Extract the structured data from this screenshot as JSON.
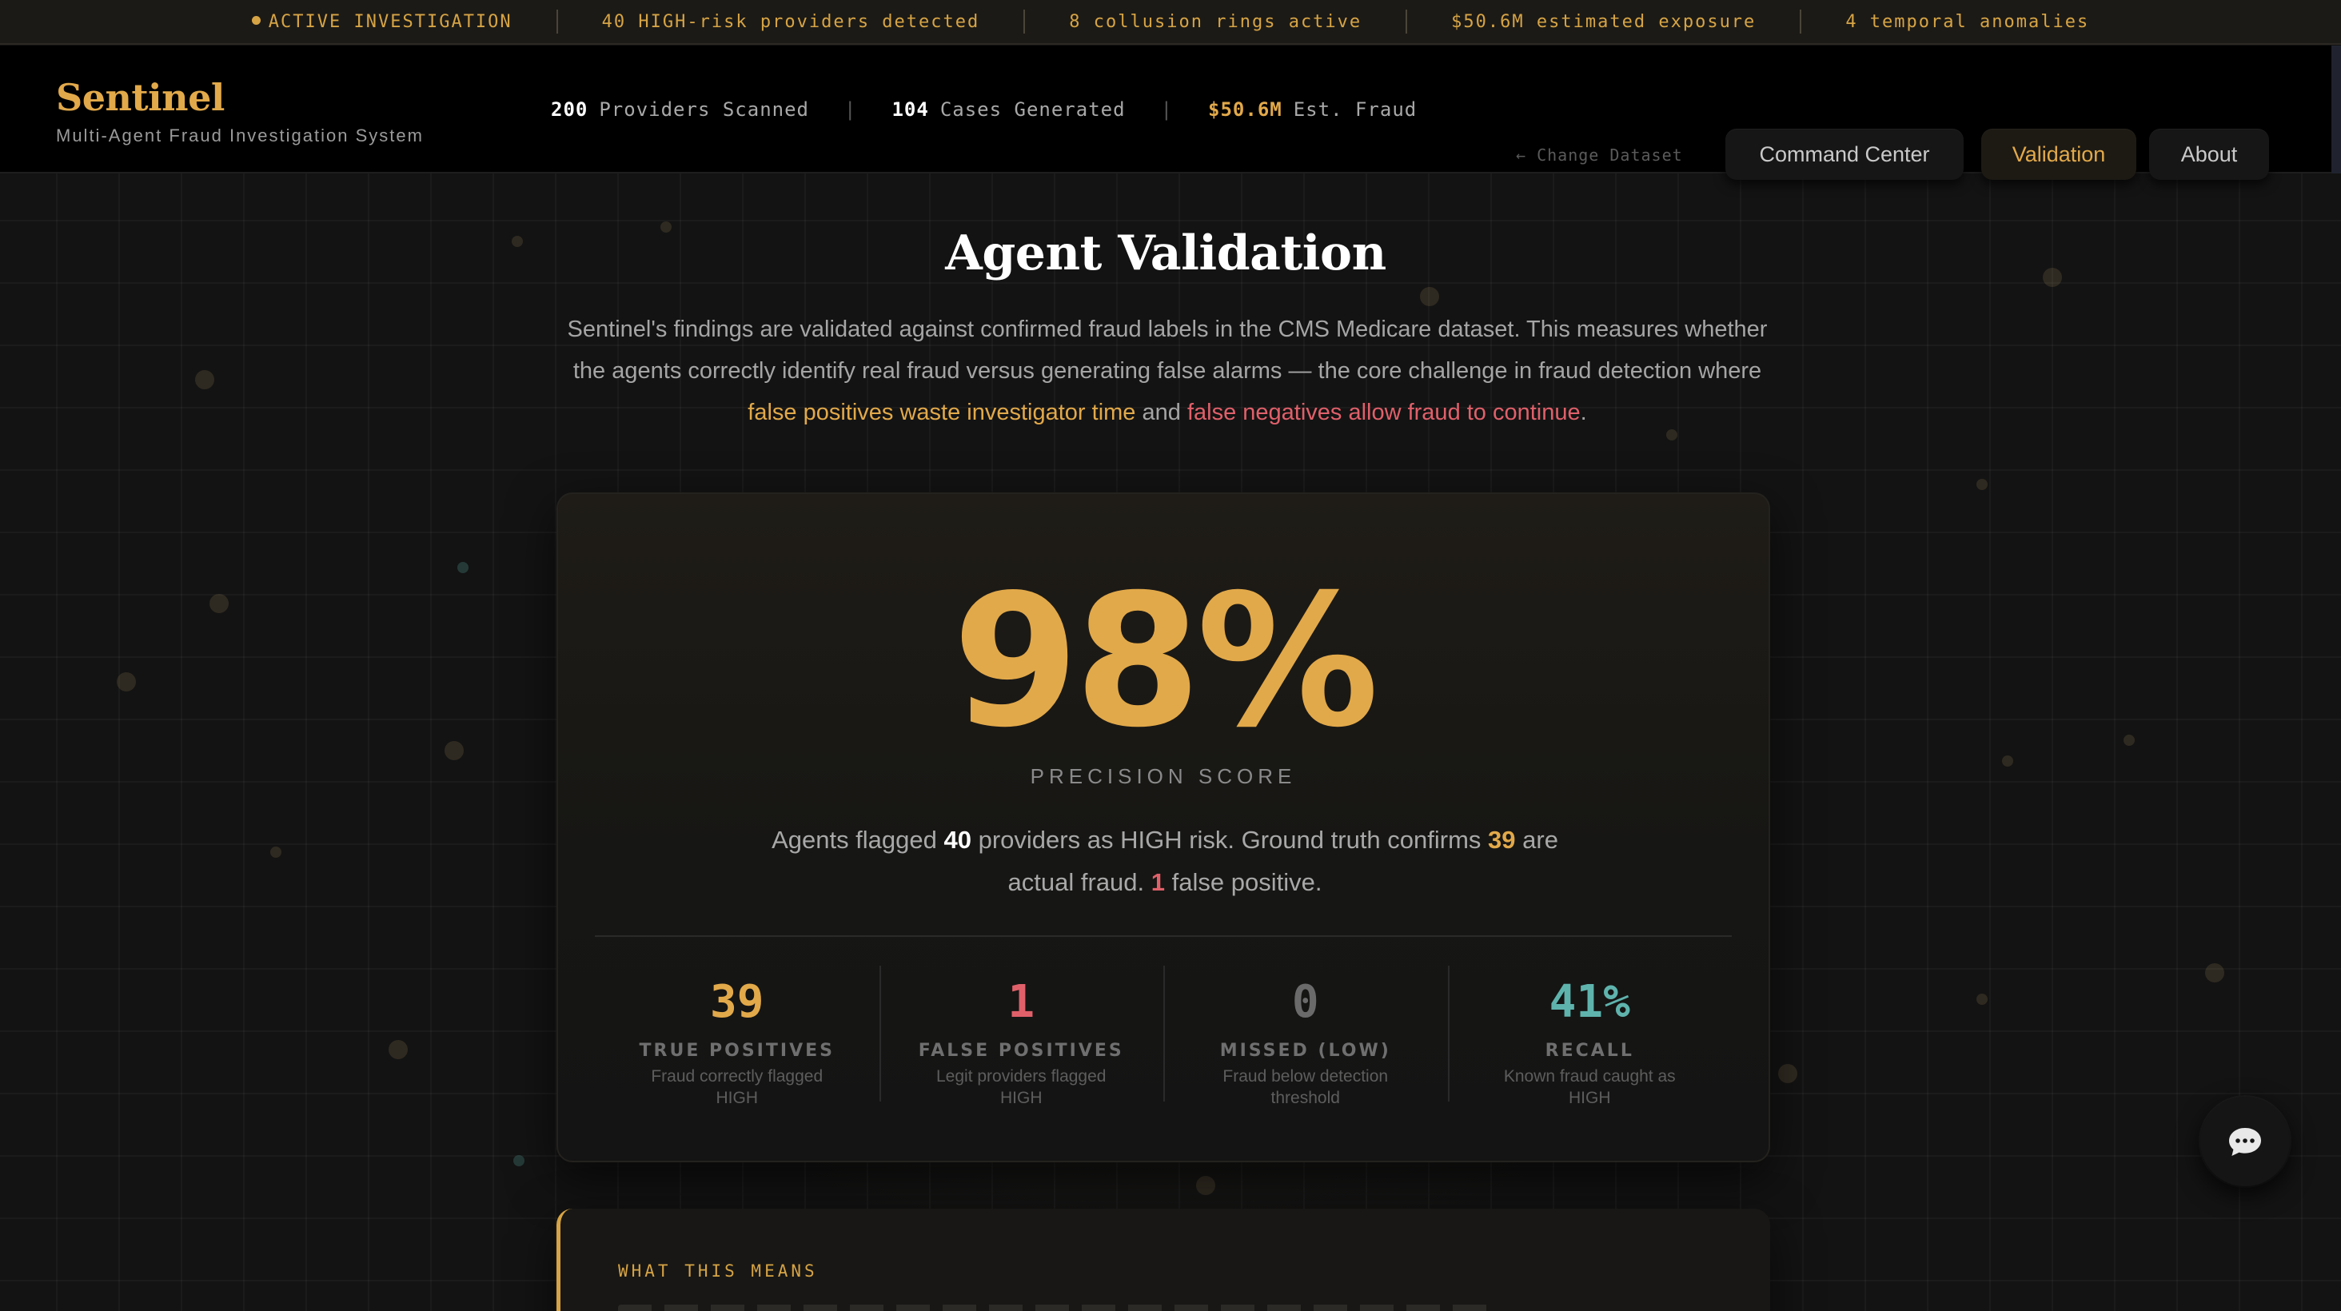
{
  "ticker": {
    "status": "ACTIVE INVESTIGATION",
    "items": [
      "40 HIGH-risk providers detected",
      "8 collusion rings active",
      "$50.6M estimated exposure",
      "4 temporal anomalies"
    ]
  },
  "brand": {
    "name": "Sentinel",
    "subtitle": "Multi-Agent Fraud Investigation System"
  },
  "header_stats": [
    {
      "value": "200",
      "label": "Providers Scanned"
    },
    {
      "value": "104",
      "label": "Cases Generated"
    },
    {
      "value": "$50.6M",
      "label": "Est. Fraud"
    }
  ],
  "change_dataset": "← Change Dataset",
  "nav": {
    "items": [
      "Command Center",
      "Validation",
      "About"
    ],
    "active": "Validation"
  },
  "page": {
    "title": "Agent Validation",
    "intro_text": "Sentinel's findings are validated against confirmed fraud labels in the CMS Medicare dataset. This measures whether the agents correctly identify real fraud versus generating false alarms — the core challenge in fraud detection where ",
    "intro_highlight_1": "false positives waste investigator time",
    "intro_connector": " and ",
    "intro_highlight_2": "false negatives allow fraud to continue",
    "intro_end": "."
  },
  "precision": {
    "score": "98%",
    "label": "PRECISION SCORE",
    "summary": {
      "p1": "Agents flagged ",
      "flagged": "40",
      "p2": " providers as HIGH risk. Ground truth confirms ",
      "confirmed": "39",
      "p3": " are actual fraud. ",
      "false_pos": "1",
      "p4": " false positive."
    }
  },
  "metrics": [
    {
      "value": "39",
      "label": "TRUE POSITIVES",
      "desc": "Fraud correctly flagged HIGH",
      "color": "#e2a94a"
    },
    {
      "value": "1",
      "label": "FALSE POSITIVES",
      "desc": "Legit providers flagged HIGH",
      "color": "#e0606a"
    },
    {
      "value": "0",
      "label": "MISSED (LOW)",
      "desc": "Fraud below detection threshold",
      "color": "#6a6a6a"
    },
    {
      "value": "41%",
      "label": "RECALL",
      "desc": "Known fraud caught as HIGH",
      "color": "#5fb3ad"
    }
  ],
  "what_this_means": {
    "eyebrow": "WHAT THIS MEANS"
  },
  "colors": {
    "accent_gold": "#e2a94a",
    "accent_red": "#e0606a",
    "accent_teal": "#5fb3ad",
    "background": "#121212"
  },
  "icons": {
    "chat": "chat-bubble-icon"
  }
}
